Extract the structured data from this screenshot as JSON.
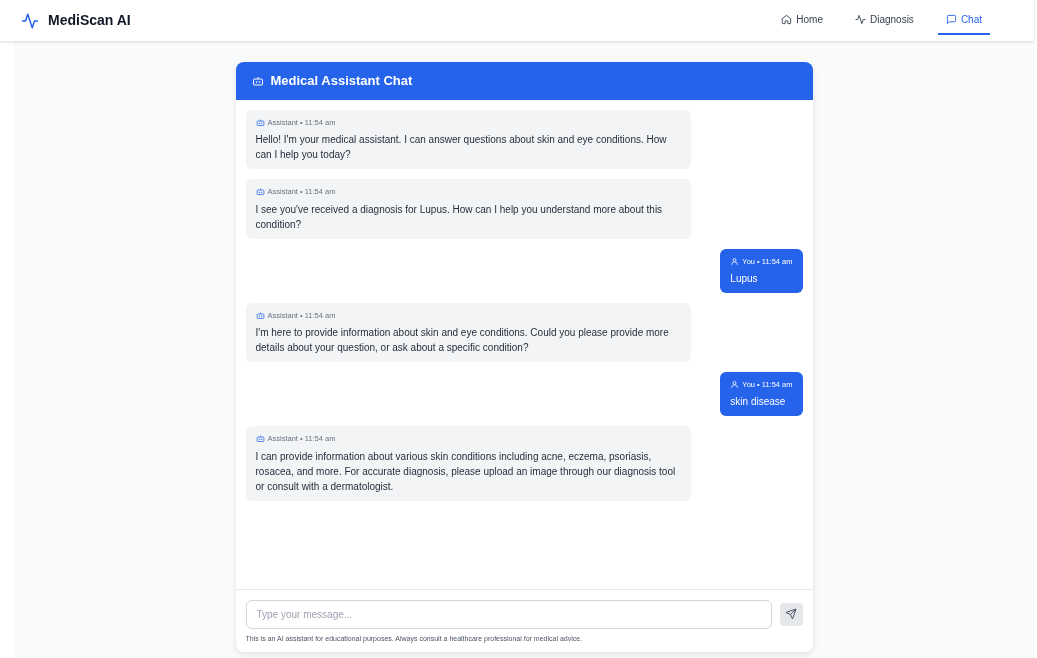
{
  "brand": "MediScan AI",
  "nav": [
    {
      "label": "Home",
      "kind": "home",
      "selected": false
    },
    {
      "label": "Diagnosis",
      "kind": "diagnosis",
      "selected": false
    },
    {
      "label": "Chat",
      "kind": "chat",
      "selected": true
    }
  ],
  "chat": {
    "title": "Medical Assistant Chat",
    "messages": [
      {
        "kind": "assistant",
        "meta": "Assistant • 11:54 am",
        "text": "Hello! I'm your medical assistant. I can answer questions about skin and eye conditions. How can I help you today?"
      },
      {
        "kind": "assistant",
        "meta": "Assistant • 11:54 am",
        "text": "I see you've received a diagnosis for Lupus. How can I help you understand more about this condition?"
      },
      {
        "kind": "user",
        "meta": "You • 11:54 am",
        "text": "Lupus"
      },
      {
        "kind": "assistant",
        "meta": "Assistant • 11:54 am",
        "text": "I'm here to provide information about skin and eye conditions. Could you please provide more details about your question, or ask about a specific condition?"
      },
      {
        "kind": "user",
        "meta": "You • 11:54 am",
        "text": "skin disease"
      },
      {
        "kind": "assistant",
        "meta": "Assistant • 11:54 am",
        "text": "I can provide information about various skin conditions including acne, eczema, psoriasis, rosacea, and more. For accurate diagnosis, please upload an image through our diagnosis tool or consult with a dermatologist."
      }
    ],
    "input": {
      "placeholder": "Type your message..."
    },
    "disclaimer": "This is an AI assistant for educational purposes. Always consult a healthcare professional for medical advice."
  }
}
